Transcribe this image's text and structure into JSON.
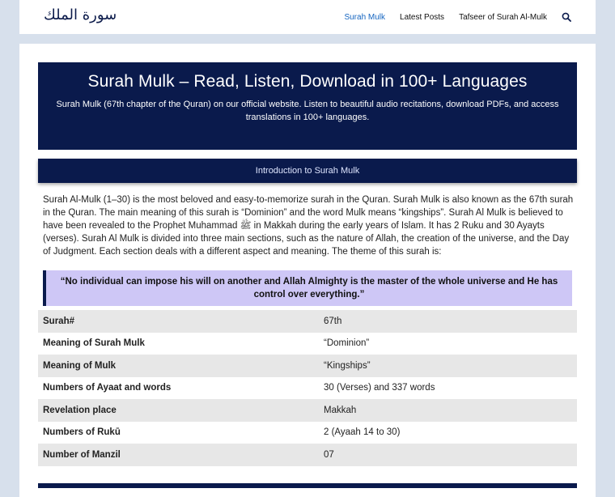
{
  "site": {
    "logo_text": "سورة الملك"
  },
  "nav": {
    "items": [
      {
        "label": "Surah Mulk",
        "active": true
      },
      {
        "label": "Latest Posts",
        "active": false
      },
      {
        "label": "Tafseer of Surah Al-Mulk",
        "active": false
      }
    ],
    "search_icon": "search-icon"
  },
  "hero": {
    "title": "Surah Mulk – Read, Listen, Download in 100+ Languages",
    "subtitle": "Surah Mulk (67th chapter of the Quran) on our official website. Listen to beautiful audio recitations, download PDFs, and access translations in 100+ languages."
  },
  "intro": {
    "heading": "Introduction to Surah Mulk",
    "paragraph": "Surah Al-Mulk (1–30) is the most beloved and easy-to-memorize surah in the Quran. Surah Mulk is also known as the 67th surah in the Quran. The main meaning of this surah is “Dominion” and the word Mulk means “kingships”. Surah Al Mulk is believed to have been revealed to the Prophet Muhammad ﷺ in Makkah during the early years of Islam. It has 2 Ruku and 30 Ayayts (verses). Surah Al Mulk is divided into three main sections, such as the nature of Allah, the creation of the universe, and the Day of Judgment. Each section deals with a different aspect and meaning. The theme of this surah is:"
  },
  "quote": {
    "text": "“No individual can impose his will on another and Allah Almighty is the master of the whole universe and He has control over everything.”"
  },
  "facts": [
    {
      "label": "Surah#",
      "value": "67th"
    },
    {
      "label": "Meaning of Surah Mulk",
      "value": "“Dominion”"
    },
    {
      "label": "Meaning of Mulk",
      "value": "“Kingships”"
    },
    {
      "label": "Numbers of Ayaat and words",
      "value": "30 (Verses) and 337 words"
    },
    {
      "label": "Revelation place",
      "value": "Makkah"
    },
    {
      "label": "Numbers of Rukū",
      "value": "2 (Ayaah 14 to 30)"
    },
    {
      "label": "Number of Manzil",
      "value": "07"
    }
  ],
  "colors": {
    "page_bg": "#d7e0ec",
    "navy": "#0a1a4c",
    "nav_active": "#1565c0",
    "quote_bg": "#cec7f6",
    "row_stripe": "#e7e7e7"
  }
}
